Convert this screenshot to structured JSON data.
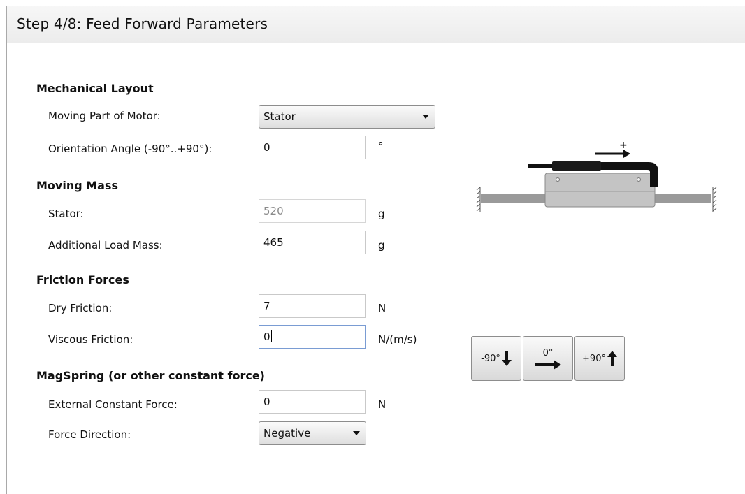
{
  "header": {
    "title": "Step 4/8: Feed Forward Parameters"
  },
  "mechanical_layout": {
    "heading": "Mechanical Layout",
    "moving_part_label": "Moving Part of Motor:",
    "moving_part_value": "Stator",
    "orientation_label": "Orientation Angle (-90°..+90°):",
    "orientation_value": "0",
    "orientation_unit": "°"
  },
  "moving_mass": {
    "heading": "Moving Mass",
    "stator_label": "Stator:",
    "stator_value": "520",
    "stator_unit": "g",
    "load_label": "Additional Load Mass:",
    "load_value": "465",
    "load_unit": "g"
  },
  "friction": {
    "heading": "Friction Forces",
    "dry_label": "Dry Friction:",
    "dry_value": "7",
    "dry_unit": "N",
    "viscous_label": "Viscous Friction:",
    "viscous_value": "0",
    "viscous_unit": "N/(m/s)"
  },
  "magspring": {
    "heading": "MagSpring (or other constant force)",
    "force_label": "External Constant Force:",
    "force_value": "0",
    "force_unit": "N",
    "direction_label": "Force Direction:",
    "direction_value": "Negative"
  },
  "orientation_buttons": {
    "minus90": "-90°",
    "zero": "0°",
    "plus90": "+90°"
  },
  "diagram": {
    "direction_sign": "+"
  }
}
